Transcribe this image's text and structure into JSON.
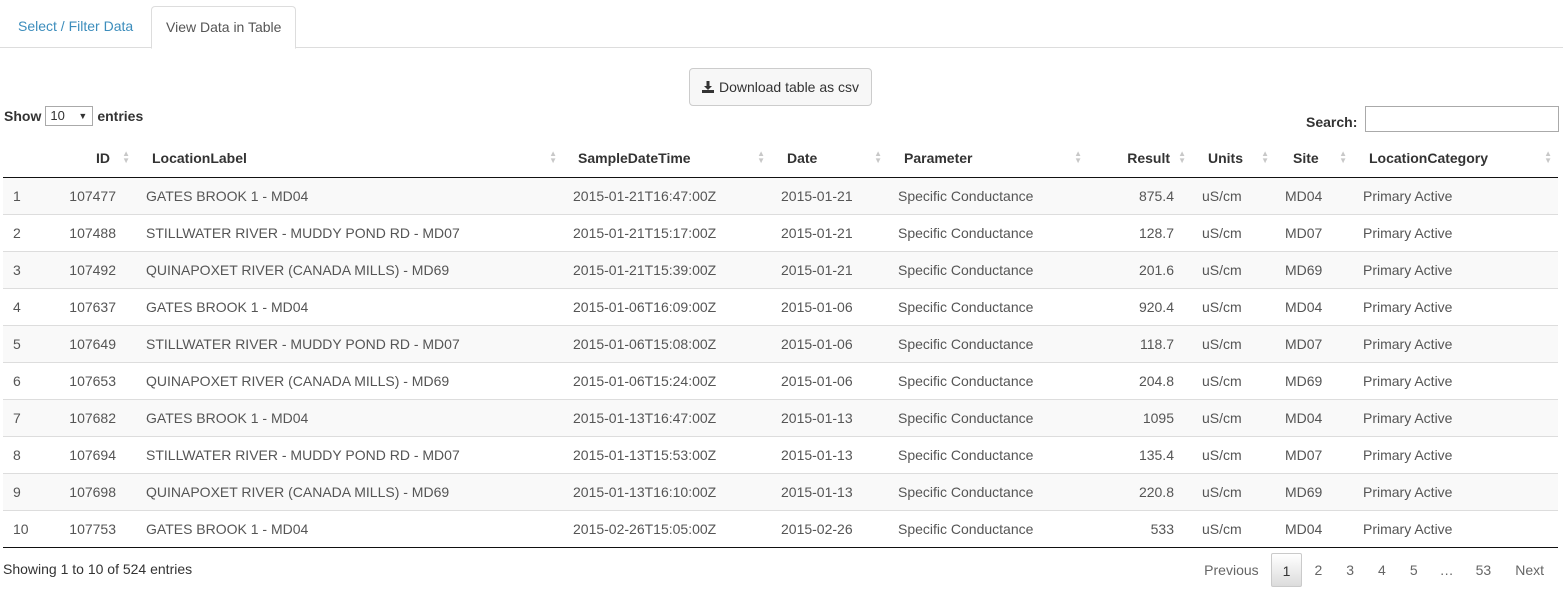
{
  "tabs": [
    {
      "label": "Select / Filter Data"
    },
    {
      "label": "View Data in Table"
    }
  ],
  "download_label": "Download table as csv",
  "length": {
    "show": "Show",
    "value": "10",
    "entries": "entries"
  },
  "search": {
    "label": "Search:",
    "value": ""
  },
  "columns": [
    "",
    "ID",
    "LocationLabel",
    "SampleDateTime",
    "Date",
    "Parameter",
    "Result",
    "Units",
    "Site",
    "LocationCategory"
  ],
  "rows": [
    {
      "n": "1",
      "id": "107477",
      "loc": "GATES BROOK 1 - MD04",
      "dt": "2015-01-21T16:47:00Z",
      "date": "2015-01-21",
      "param": "Specific Conductance",
      "result": "875.4",
      "units": "uS/cm",
      "site": "MD04",
      "cat": "Primary Active"
    },
    {
      "n": "2",
      "id": "107488",
      "loc": "STILLWATER RIVER - MUDDY POND RD - MD07",
      "dt": "2015-01-21T15:17:00Z",
      "date": "2015-01-21",
      "param": "Specific Conductance",
      "result": "128.7",
      "units": "uS/cm",
      "site": "MD07",
      "cat": "Primary Active"
    },
    {
      "n": "3",
      "id": "107492",
      "loc": "QUINAPOXET RIVER (CANADA MILLS) - MD69",
      "dt": "2015-01-21T15:39:00Z",
      "date": "2015-01-21",
      "param": "Specific Conductance",
      "result": "201.6",
      "units": "uS/cm",
      "site": "MD69",
      "cat": "Primary Active"
    },
    {
      "n": "4",
      "id": "107637",
      "loc": "GATES BROOK 1 - MD04",
      "dt": "2015-01-06T16:09:00Z",
      "date": "2015-01-06",
      "param": "Specific Conductance",
      "result": "920.4",
      "units": "uS/cm",
      "site": "MD04",
      "cat": "Primary Active"
    },
    {
      "n": "5",
      "id": "107649",
      "loc": "STILLWATER RIVER - MUDDY POND RD - MD07",
      "dt": "2015-01-06T15:08:00Z",
      "date": "2015-01-06",
      "param": "Specific Conductance",
      "result": "118.7",
      "units": "uS/cm",
      "site": "MD07",
      "cat": "Primary Active"
    },
    {
      "n": "6",
      "id": "107653",
      "loc": "QUINAPOXET RIVER (CANADA MILLS) - MD69",
      "dt": "2015-01-06T15:24:00Z",
      "date": "2015-01-06",
      "param": "Specific Conductance",
      "result": "204.8",
      "units": "uS/cm",
      "site": "MD69",
      "cat": "Primary Active"
    },
    {
      "n": "7",
      "id": "107682",
      "loc": "GATES BROOK 1 - MD04",
      "dt": "2015-01-13T16:47:00Z",
      "date": "2015-01-13",
      "param": "Specific Conductance",
      "result": "1095",
      "units": "uS/cm",
      "site": "MD04",
      "cat": "Primary Active"
    },
    {
      "n": "8",
      "id": "107694",
      "loc": "STILLWATER RIVER - MUDDY POND RD - MD07",
      "dt": "2015-01-13T15:53:00Z",
      "date": "2015-01-13",
      "param": "Specific Conductance",
      "result": "135.4",
      "units": "uS/cm",
      "site": "MD07",
      "cat": "Primary Active"
    },
    {
      "n": "9",
      "id": "107698",
      "loc": "QUINAPOXET RIVER (CANADA MILLS) - MD69",
      "dt": "2015-01-13T16:10:00Z",
      "date": "2015-01-13",
      "param": "Specific Conductance",
      "result": "220.8",
      "units": "uS/cm",
      "site": "MD69",
      "cat": "Primary Active"
    },
    {
      "n": "10",
      "id": "107753",
      "loc": "GATES BROOK 1 - MD04",
      "dt": "2015-02-26T15:05:00Z",
      "date": "2015-02-26",
      "param": "Specific Conductance",
      "result": "533",
      "units": "uS/cm",
      "site": "MD04",
      "cat": "Primary Active"
    }
  ],
  "info": "Showing 1 to 10 of 524 entries",
  "pager": {
    "previous": "Previous",
    "pages": [
      "1",
      "2",
      "3",
      "4",
      "5"
    ],
    "ellipsis": "…",
    "last": "53",
    "next": "Next",
    "current": "1"
  }
}
